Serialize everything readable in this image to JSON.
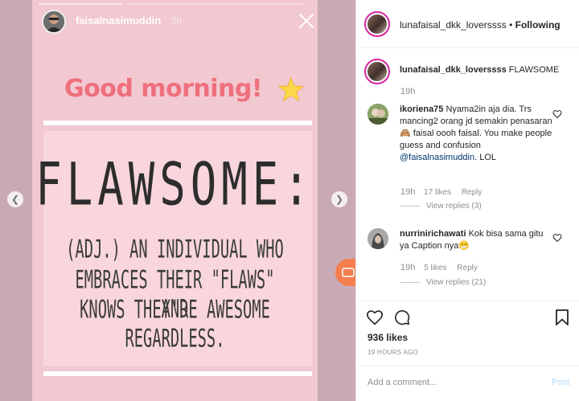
{
  "story": {
    "username": "faisalnasimuddin",
    "time": "3h",
    "greeting": "Good morning!",
    "word": "FLAWSOME:",
    "definition": [
      "(ADJ.) AN INDIVIDUAL WHO",
      "EMBRACES THEIR \"FLAWS\" AND",
      "KNOWS THEY'RE AWESOME",
      "REGARDLESS."
    ],
    "prev_icon": "chevron-left-icon",
    "next_icon": "chevron-right-icon"
  },
  "header": {
    "username": "lunafaisal_dkk_loverssss",
    "separator": "•",
    "follow_state": "Following"
  },
  "caption": {
    "username": "lunafaisal_dkk_loverssss",
    "text": "FLAWSOME",
    "time": "19h"
  },
  "comments": [
    {
      "username": "ikoriena75",
      "text_before": "Nyama2in aja dia. Trs mancing2 orang jd semakin penasaran 🙈 faisal oooh faisal. You make people guess and confusion ",
      "mention": "@faisalnasimuddin",
      "text_after": ". LOL",
      "time": "19h",
      "likes": "17 likes",
      "reply": "Reply",
      "view_replies": "View replies (3)"
    },
    {
      "username": "nurriniri​chawati",
      "text_before": "Kok bisa sama gitu ya Caption nya😁",
      "mention": "",
      "text_after": "",
      "time": "19h",
      "likes": "5 likes",
      "reply": "Reply",
      "view_replies": "View replies (21)"
    }
  ],
  "actions": {
    "likes": "936 likes",
    "ago": "19 HOURS AGO"
  },
  "composer": {
    "placeholder": "Add a comment...",
    "post": "Post"
  },
  "colors": {
    "greeting": "#ef6f7c",
    "mention": "#003569",
    "post_disabled": "#b2dffc"
  }
}
